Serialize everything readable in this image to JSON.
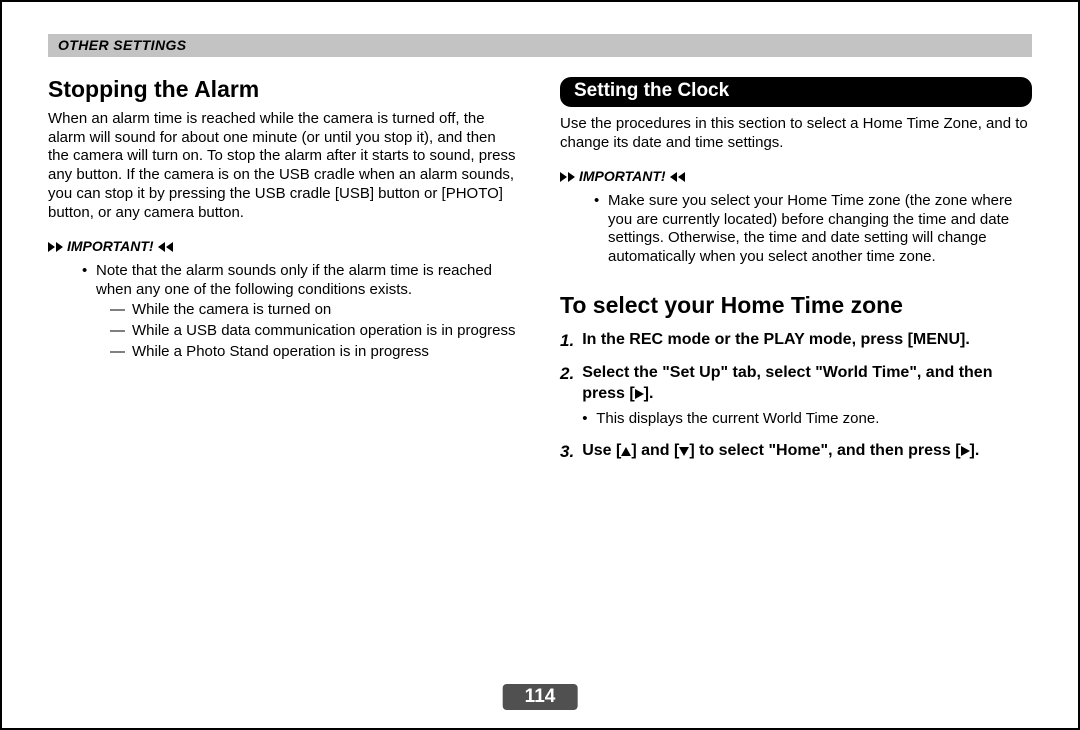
{
  "header": {
    "section": "OTHER SETTINGS"
  },
  "left": {
    "heading": "Stopping the Alarm",
    "paragraph": "When an alarm time is reached while the camera is turned off, the alarm will sound for about one minute (or until you stop it), and then the camera will turn on. To stop the alarm after it starts to sound, press any button. If the camera is on the USB cradle when an alarm sounds, you can stop it by pressing the USB cradle [USB] button or [PHOTO] button, or any camera button.",
    "important_label": "IMPORTANT!",
    "note_intro": "Note that the alarm sounds only if the alarm time is reached when any one of the following conditions exists.",
    "conditions": [
      "While the camera is turned on",
      "While a USB data communication operation is in progress",
      "While a Photo Stand operation is in progress"
    ]
  },
  "right": {
    "pill": "Setting the Clock",
    "intro": "Use the procedures in this section to select a Home Time Zone, and to change its date and time settings.",
    "important_label": "IMPORTANT!",
    "note": "Make sure you select your Home Time zone (the zone where you are currently located) before changing the time and date settings. Otherwise, the time and date setting will change automatically when you select another time zone.",
    "sub_heading": "To select your Home Time zone",
    "steps": [
      {
        "num": "1.",
        "text_before": "In the REC mode or the PLAY mode, press [MENU].",
        "sub": ""
      },
      {
        "num": "2.",
        "text_before": "Select the \"Set Up\" tab, select \"World Time\", and then press [",
        "glyph": "right",
        "text_after": "].",
        "sub": "This displays the current World Time zone."
      },
      {
        "num": "3.",
        "parts": [
          "Use [",
          "up",
          "] and [",
          "down",
          "] to select \"Home\", and then press [",
          "right",
          "]."
        ]
      }
    ]
  },
  "page_number": "114"
}
